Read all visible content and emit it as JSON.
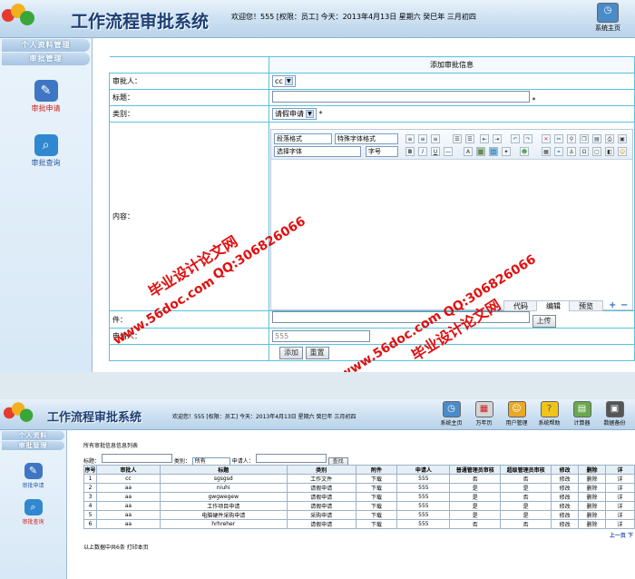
{
  "top": {
    "title": "工作流程审批系统",
    "info": "欢迎您！555 [权限：员工] 今天：2013年4月13日 星期六 癸巳年 三月初四",
    "toolbar": [
      "系统主页"
    ],
    "side_menus": [
      "个人资料管理",
      "审批管理"
    ],
    "side_items": [
      "审批申请",
      "审批查询"
    ],
    "form": {
      "heading": "添加审批信息",
      "approver_label": "审批人：",
      "approver_value": "cc",
      "title_label": "标题：",
      "title_required": "*",
      "type_label": "类别：",
      "type_value": "请假申请",
      "content_label": "内容：",
      "editor_selects": [
        "段落格式",
        "特殊字体格式",
        "选择字体",
        "字号"
      ],
      "editor_tabs": [
        "代码",
        "编辑",
        "预览"
      ],
      "attach_label": "件：",
      "upload_button": "上传",
      "applicant_label": "申请人：",
      "applicant_value": "555",
      "add_button": "添加",
      "reset_button": "重置"
    },
    "watermarks": [
      "毕业设计论文网",
      "QQ:306826066",
      "www.56doc.com"
    ]
  },
  "bottom": {
    "title": "工作流程审批系统",
    "info": "欢迎您！555 [权限：员工] 今天：2013年4月13日 星期六 癸巳年 三月初四",
    "toolbar": [
      "系统主页",
      "万年历",
      "用户管理",
      "系统帮助",
      "计算器",
      "数据备份"
    ],
    "side_menus": [
      "个人资料",
      "审批管理"
    ],
    "side_items": [
      "审批申请",
      "审批查询"
    ],
    "list_title": "所有审批信息信息列表",
    "search": {
      "title_label": "标题：",
      "type_label": "类别：",
      "type_value": "所有",
      "applicant_label": "申请人：",
      "button": "查找"
    },
    "table": {
      "headers": [
        "序号",
        "审批人",
        "标题",
        "类别",
        "附件",
        "申请人",
        "普通管理员审核",
        "超级管理员审核",
        "修改",
        "删除",
        "详"
      ],
      "rows": [
        [
          "1",
          "cc",
          "sgsgsd",
          "工作文件",
          "下载",
          "555",
          "否",
          "否",
          "修改",
          "删除",
          "详"
        ],
        [
          "2",
          "aa",
          "niuhi",
          "请假申请",
          "下载",
          "555",
          "是",
          "是",
          "修改",
          "删除",
          "详"
        ],
        [
          "3",
          "aa",
          "gwgwegew",
          "请假申请",
          "下载",
          "555",
          "是",
          "否",
          "修改",
          "删除",
          "详"
        ],
        [
          "4",
          "aa",
          "工作项目申请",
          "请假申请",
          "下载",
          "555",
          "是",
          "是",
          "修改",
          "删除",
          "详"
        ],
        [
          "5",
          "aa",
          "电脑硬件采购申请",
          "采购申请",
          "下载",
          "555",
          "是",
          "是",
          "修改",
          "删除",
          "详"
        ],
        [
          "6",
          "aa",
          "hrhreher",
          "请假申请",
          "下载",
          "555",
          "否",
          "否",
          "修改",
          "删除",
          "详"
        ]
      ]
    },
    "pager": "上一页 下",
    "footer": "以上数据中共6条  打印本页"
  }
}
